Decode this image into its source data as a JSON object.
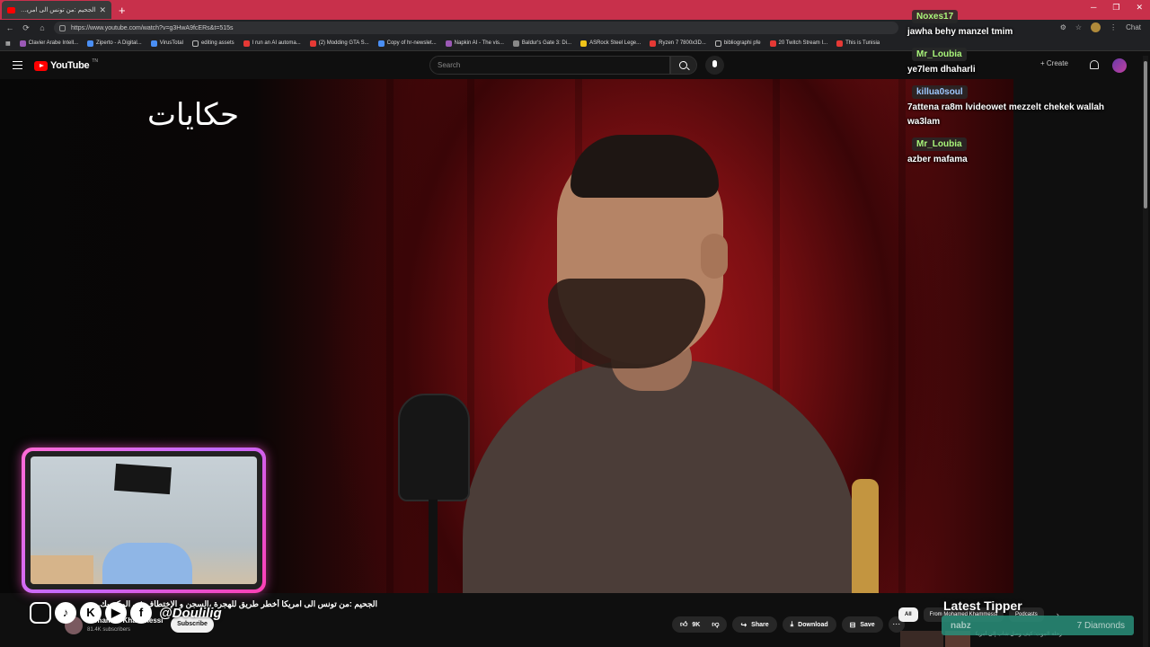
{
  "browser": {
    "tab_title": "الجحيم :من تونس الى امريكا أخطر طر...",
    "url": "https://www.youtube.com/watch?v=g3HwA9fcERs&t=515s",
    "chat_label": "Chat",
    "bookmarks": [
      "Clavier Arabe Intell...",
      "Ziperto - A Digital...",
      "VirusTotal",
      "editing assets",
      "I run an AI automa...",
      "(2) Modding GTA S...",
      "Copy of hr-newslet...",
      "Napkin AI - The vis...",
      "Baldur's Gate 3: Di...",
      "ASRock Steel Lege...",
      "Ryzen 7 7800x3D...",
      "bibliographi pfe",
      "20 Twitch Stream I...",
      "This is Tunisia"
    ]
  },
  "youtube": {
    "logo_text": "YouTube",
    "logo_tn": "TN",
    "search_placeholder": "Search",
    "create_label": "+ Create"
  },
  "video": {
    "brandmark": "حكايات",
    "title": "الجحيم :من تونس الى امريكا أخطر طريق للهجرة ،السجن و الإختطاف في المكسيك...",
    "channel_name": "Mohamed Khammessi",
    "subscribers": "81.4K subscribers",
    "subscribe_label": "Subscribe",
    "like_count": "9K",
    "share_label": "Share",
    "download_label": "Download",
    "save_label": "Save"
  },
  "overlay": {
    "handle": "@Doulilig",
    "social_icons": [
      "instagram-icon",
      "tiktok-icon",
      "kick-icon",
      "youtube-icon",
      "facebook-icon"
    ],
    "latest_tipper_label": "Latest Tipper",
    "tipper_name": "nabz",
    "tipper_amount": "7 Diamonds"
  },
  "chips": {
    "all": "All",
    "from_channel": "From Mohamed Khammessi",
    "podcasts": "Podcasts"
  },
  "recommended": {
    "title": "رحلة الموت: كيف وصل شاب إلى أمريكا"
  },
  "chat": {
    "messages": [
      {
        "user": "Noxes17",
        "text": "jawha behy manzel tmim",
        "color": "green"
      },
      {
        "user": "Mr_Loubia",
        "text": "ye7lem dhaharli",
        "color": "green"
      },
      {
        "user": "killua0soul",
        "text": "7attena ra8m lvideowet mezzelt chekek wallah wa3lam",
        "color": "blue"
      },
      {
        "user": "Mr_Loubia",
        "text": "azber mafama",
        "color": "green"
      }
    ]
  }
}
